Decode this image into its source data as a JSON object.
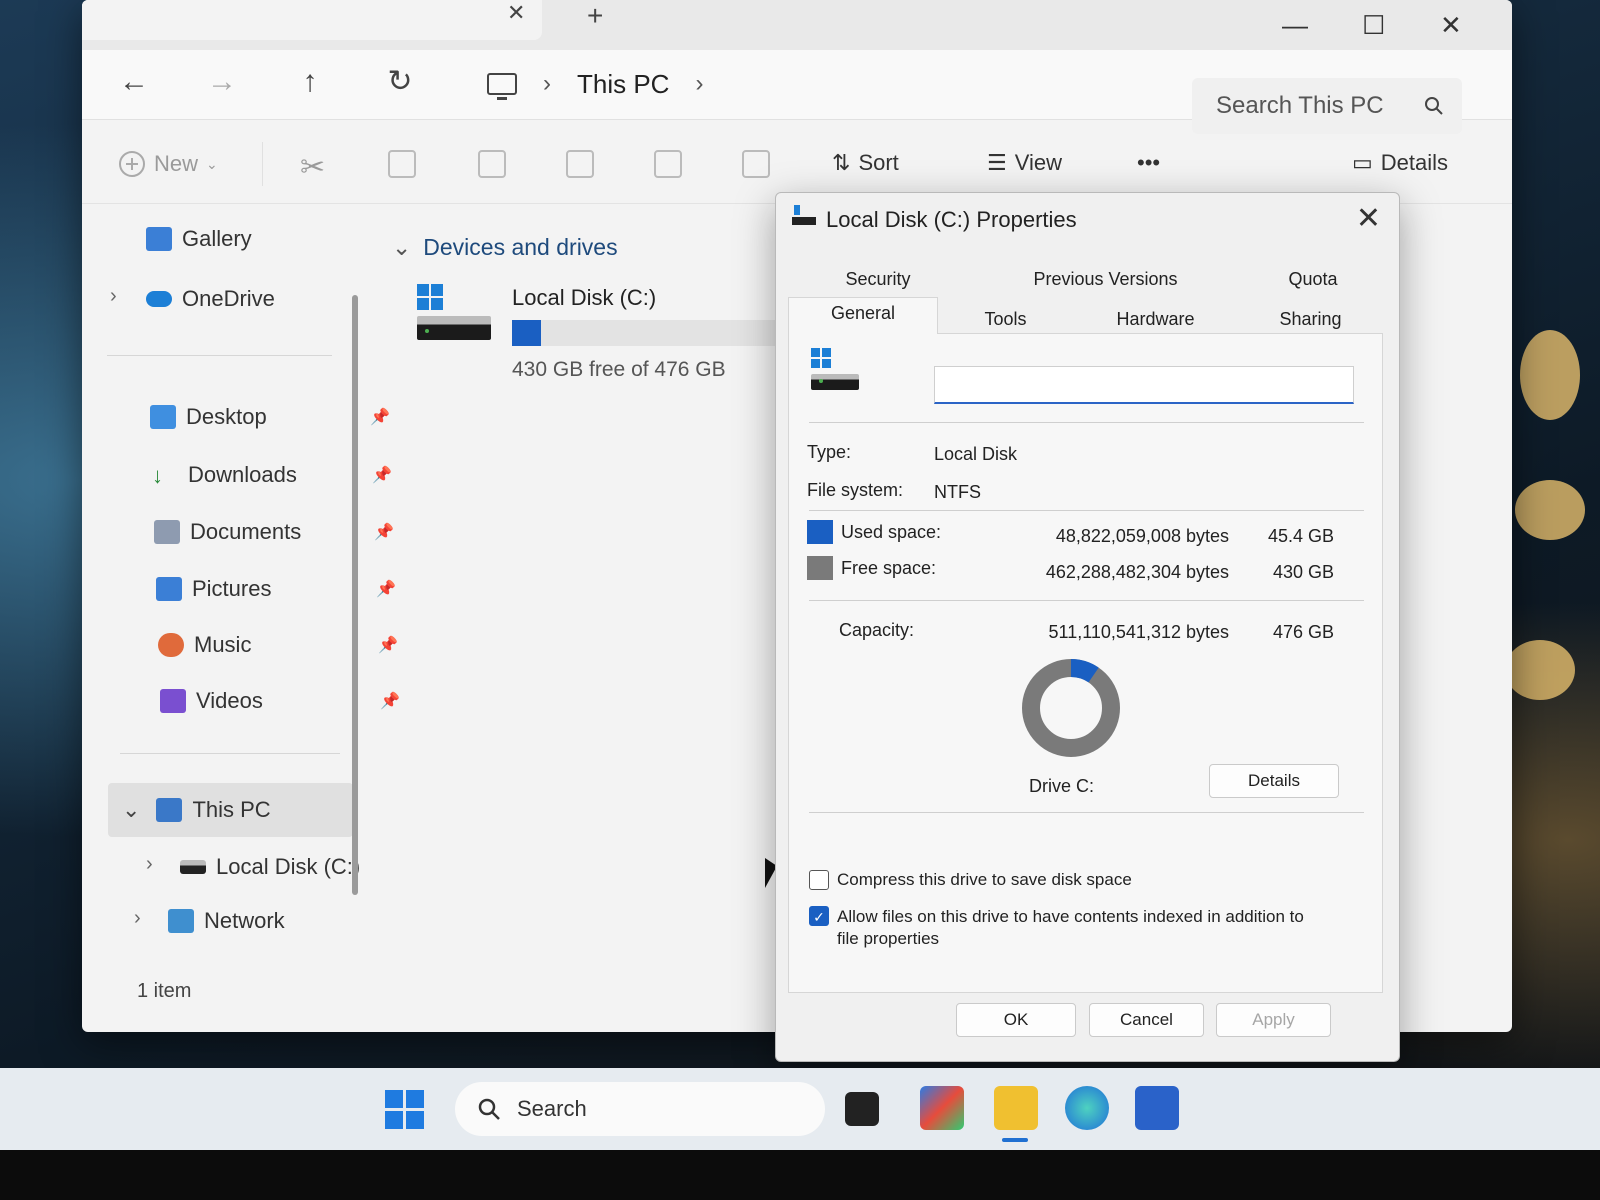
{
  "explorer": {
    "window_controls": {
      "minimize": "—",
      "maximize": "☐",
      "close": "✕"
    },
    "tab_close": "✕",
    "new_tab": "+",
    "nav": {
      "back": "←",
      "forward": "→",
      "up": "↑",
      "refresh": "↻"
    },
    "breadcrumb": {
      "location": "This PC",
      "sep": "›"
    },
    "search_placeholder": "Search This PC",
    "command_bar": {
      "new_label": "New",
      "sort_label": "Sort",
      "view_label": "View",
      "more_label": "•••",
      "details_label": "Details"
    },
    "sidebar": {
      "top_items": [
        {
          "label": "Gallery",
          "icon": "gallery-icon"
        },
        {
          "label": "OneDrive",
          "icon": "onedrive-icon"
        }
      ],
      "pinned_items": [
        {
          "label": "Desktop",
          "icon": "desktop-folder-icon"
        },
        {
          "label": "Downloads",
          "icon": "downloads-icon"
        },
        {
          "label": "Documents",
          "icon": "documents-icon"
        },
        {
          "label": "Pictures",
          "icon": "pictures-icon"
        },
        {
          "label": "Music",
          "icon": "music-icon"
        },
        {
          "label": "Videos",
          "icon": "videos-icon"
        }
      ],
      "this_pc": "This PC",
      "local_disk": "Local Disk (C:)",
      "network": "Network"
    },
    "status_bar": "1 item",
    "content": {
      "group_header": "Devices and drives",
      "drive": {
        "name": "Local Disk (C:)",
        "free_text": "430 GB free of 476 GB",
        "used_fraction": 0.097
      }
    }
  },
  "dialog": {
    "title": "Local Disk (C:) Properties",
    "close": "✕",
    "tabs_row1": [
      "Security",
      "Previous Versions",
      "Quota"
    ],
    "tabs_row2": [
      "General",
      "Tools",
      "Hardware",
      "Sharing"
    ],
    "active_tab": "General",
    "volume_label_value": "",
    "type_label": "Type:",
    "type_value": "Local Disk",
    "fs_label": "File system:",
    "fs_value": "NTFS",
    "used_label": "Used space:",
    "used_bytes": "48,822,059,008 bytes",
    "used_gb": "45.4 GB",
    "free_label": "Free space:",
    "free_bytes": "462,288,482,304 bytes",
    "free_gb": "430 GB",
    "capacity_label": "Capacity:",
    "capacity_bytes": "511,110,541,312 bytes",
    "capacity_gb": "476 GB",
    "drive_caption": "Drive C:",
    "details_button": "Details",
    "compress_label": "Compress this drive to save disk space",
    "compress_checked": false,
    "index_label": "Allow files on this drive to have contents indexed in addition to file properties",
    "index_checked": true,
    "ok": "OK",
    "cancel": "Cancel",
    "apply": "Apply",
    "colors": {
      "used": "#1a5fc2",
      "free": "#7a7a7a"
    },
    "used_fraction": 0.0955
  },
  "taskbar": {
    "search_label": "Search",
    "apps": [
      "task-view-icon",
      "store-icon",
      "file-explorer-icon",
      "edge-icon",
      "microsoft-store-icon"
    ]
  }
}
